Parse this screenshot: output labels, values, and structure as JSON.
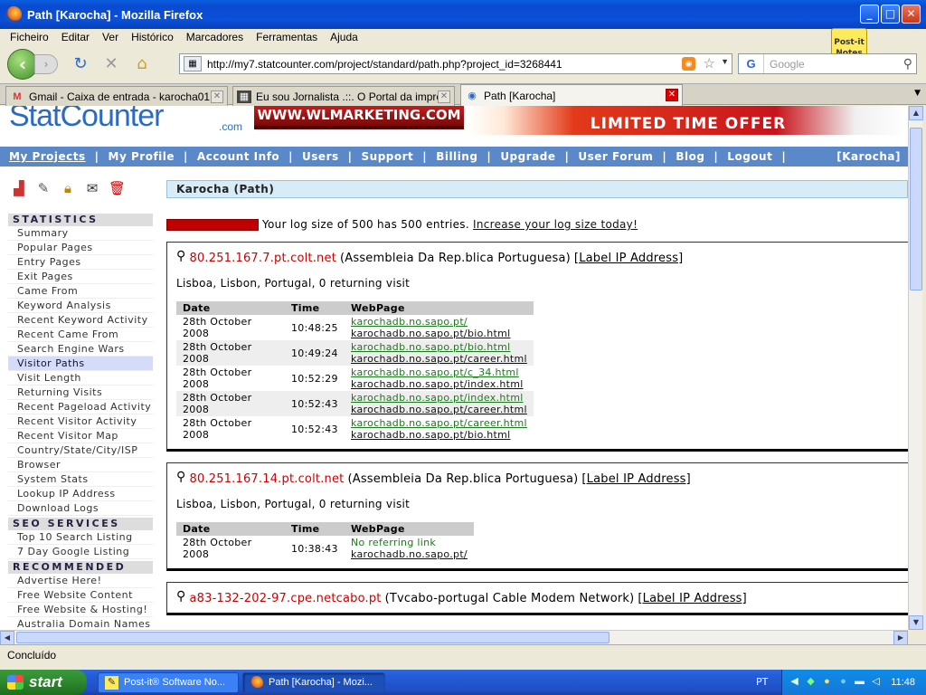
{
  "window": {
    "title": "Path [Karocha] - Mozilla Firefox"
  },
  "menu": [
    "Ficheiro",
    "Editar",
    "Ver",
    "Histórico",
    "Marcadores",
    "Ferramentas",
    "Ajuda"
  ],
  "url": "http://my7.statcounter.com/project/standard/path.php?project_id=3268441",
  "search_placeholder": "Google",
  "postit": {
    "line1": "Post-it",
    "line2": "Notes"
  },
  "tabs": [
    {
      "label": "Gmail - Caixa de entrada - karocha01...",
      "icon": "gmail-icon"
    },
    {
      "label": "Eu sou Jornalista .::. O Portal da impre...",
      "icon": "site-icon"
    },
    {
      "label": "Path [Karocha]",
      "icon": "statcounter-icon"
    }
  ],
  "banner": {
    "logo": "StatCounter",
    "logo_com": ".com",
    "ad1": "WWW.WLMARKETING.COM",
    "ad2": "LIMITED TIME OFFER"
  },
  "topnav": {
    "items": [
      "My Projects",
      "My Profile",
      "Account Info",
      "Users",
      "Support",
      "Billing",
      "Upgrade",
      "User Forum",
      "Blog",
      "Logout"
    ],
    "user": "[Karocha]"
  },
  "sidebar": {
    "statistics_head": "STATISTICS",
    "statistics": [
      "Summary",
      "Popular Pages",
      "Entry Pages",
      "Exit Pages",
      "Came From",
      "Keyword Analysis",
      "Recent Keyword Activity",
      "Recent Came From",
      "Search Engine Wars",
      "Visitor Paths",
      "Visit Length",
      "Returning Visits",
      "Recent Pageload Activity",
      "Recent Visitor Activity",
      "Recent Visitor Map",
      "Country/State/City/ISP",
      "Browser",
      "System Stats",
      "Lookup IP Address",
      "Download Logs"
    ],
    "seo_head": "SEO SERVICES",
    "seo": [
      "Top 10 Search Listing",
      "7 Day Google Listing"
    ],
    "rec_head": "RECOMMENDED",
    "rec": [
      "Advertise Here!",
      "Free Website Content",
      "Free Website & Hosting!",
      "Australia Domain Names"
    ]
  },
  "main": {
    "header": "Karocha (Path)",
    "log_text": "Your log size of 500 has 500 entries.",
    "log_link": "Increase your log size today!",
    "col_date": "Date",
    "col_time": "Time",
    "col_page": "WebPage",
    "label_ip": "[Label IP Address]",
    "visits": [
      {
        "ip": "80.251.167.7.pt.colt.net",
        "org": "(Assembleia Da Rep.blica Portuguesa)",
        "location": "Lisboa, Lisbon, Portugal, 0 returning visit",
        "rows": [
          {
            "date": "28th October 2008",
            "time": "10:48:25",
            "from": "karochadb.no.sapo.pt/",
            "to": "karochadb.no.sapo.pt/bio.html"
          },
          {
            "date": "28th October 2008",
            "time": "10:49:24",
            "from": "karochadb.no.sapo.pt/bio.html",
            "to": "karochadb.no.sapo.pt/career.html"
          },
          {
            "date": "28th October 2008",
            "time": "10:52:29",
            "from": "karochadb.no.sapo.pt/c_34.html",
            "to": "karochadb.no.sapo.pt/index.html"
          },
          {
            "date": "28th October 2008",
            "time": "10:52:43",
            "from": "karochadb.no.sapo.pt/index.html",
            "to": "karochadb.no.sapo.pt/career.html"
          },
          {
            "date": "28th October 2008",
            "time": "10:52:43",
            "from": "karochadb.no.sapo.pt/career.html",
            "to": "karochadb.no.sapo.pt/bio.html"
          }
        ]
      },
      {
        "ip": "80.251.167.14.pt.colt.net",
        "org": "(Assembleia Da Rep.blica Portuguesa)",
        "location": "Lisboa, Lisbon, Portugal, 0 returning visit",
        "rows": [
          {
            "date": "28th October 2008",
            "time": "10:38:43",
            "from": "No referring link",
            "to": "karochadb.no.sapo.pt/"
          }
        ]
      },
      {
        "ip": "a83-132-202-97.cpe.netcabo.pt",
        "org": "(Tvcabo-portugal Cable Modem Network)",
        "location": "",
        "rows": []
      }
    ]
  },
  "status": "Concluído",
  "taskbar": {
    "start": "start",
    "items": [
      "Post-it® Software No...",
      "Path [Karocha] - Mozi..."
    ],
    "lang": "PT",
    "clock": "11:48"
  }
}
